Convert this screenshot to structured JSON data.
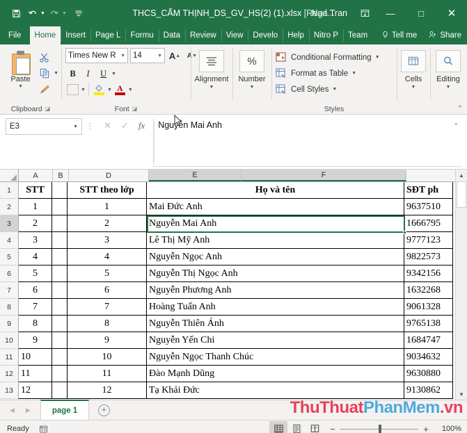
{
  "titlebar": {
    "save_icon": "save-icon",
    "undo_icon": "undo-icon",
    "redo_icon": "redo-icon",
    "customize_icon": "customize-quick-access-icon",
    "document_title": "THCS_CẤM THỊNH_DS_GV_HS(2) (1).xlsx",
    "readonly_tag": "[Read...",
    "user_name": "Nga Tran",
    "ribbon_display_icon": "ribbon-display-options-icon",
    "minimize": "—",
    "maximize": "□",
    "close": "✕"
  },
  "ribbon_tabs": [
    {
      "label": "File",
      "active": false
    },
    {
      "label": "Home",
      "active": true
    },
    {
      "label": "Insert",
      "active": false
    },
    {
      "label": "Page L",
      "active": false
    },
    {
      "label": "Formu",
      "active": false
    },
    {
      "label": "Data",
      "active": false
    },
    {
      "label": "Review",
      "active": false
    },
    {
      "label": "View",
      "active": false
    },
    {
      "label": "Develo",
      "active": false
    },
    {
      "label": "Help",
      "active": false
    },
    {
      "label": "Nitro P",
      "active": false
    },
    {
      "label": "Team",
      "active": false
    }
  ],
  "ribbon_right": {
    "tell_me": "Tell me",
    "tell_me_icon": "lightbulb-icon",
    "share": "Share",
    "share_icon": "share-person-icon"
  },
  "ribbon": {
    "clipboard": {
      "group_label": "Clipboard",
      "paste_label": "Paste",
      "paste_icon": "paste-clipboard-icon",
      "cut_icon": "scissors-icon",
      "copy_icon": "copy-icon",
      "format_painter_icon": "format-painter-icon",
      "launcher_icon": "dialog-launcher-icon"
    },
    "font": {
      "group_label": "Font",
      "font_name": "Times New R",
      "font_size": "14",
      "bold": "B",
      "italic": "I",
      "underline": "U",
      "increase_font": "A",
      "decrease_font": "A",
      "borders_icon": "borders-icon",
      "fill_color_icon": "fill-color-icon",
      "font_color_icon": "font-color-icon",
      "fill_color": "#ffe600",
      "font_color": "#c00000",
      "launcher_icon": "dialog-launcher-icon"
    },
    "alignment": {
      "label": "Alignment",
      "icon": "alignment-icon"
    },
    "number": {
      "label": "Number",
      "icon": "percent-icon",
      "glyph": "%"
    },
    "styles": {
      "group_label": "Styles",
      "items": [
        {
          "label": "Conditional Formatting",
          "icon": "conditional-formatting-icon"
        },
        {
          "label": "Format as Table",
          "icon": "format-as-table-icon"
        },
        {
          "label": "Cell Styles",
          "icon": "cell-styles-icon"
        }
      ]
    },
    "cells": {
      "label": "Cells",
      "icon": "cells-icon"
    },
    "editing": {
      "label": "Editing",
      "icon": "find-select-icon"
    },
    "collapse_ribbon_icon": "collapse-ribbon-chevron-icon"
  },
  "formula_bar": {
    "name_box_value": "E3",
    "name_box_caret_icon": "chevron-down-icon",
    "cancel_icon": "cancel-x-icon",
    "enter_icon": "enter-check-icon",
    "insert_function_icon": "fx-icon",
    "formula_value": "Nguyễn Mai Anh",
    "expand_icon": "expand-formula-bar-icon"
  },
  "grid": {
    "columns": [
      {
        "letter": "A",
        "selected": false
      },
      {
        "letter": "B",
        "selected": false
      },
      {
        "letter": "D",
        "selected": false
      },
      {
        "letter": "E",
        "selected": true
      },
      {
        "letter": "F",
        "selected": true
      },
      {
        "letter": "",
        "selected": false
      }
    ],
    "row_numbers": [
      "1",
      "2",
      "3",
      "4",
      "5",
      "6",
      "7",
      "8",
      "9",
      "10",
      "11",
      "12",
      "13"
    ],
    "selected_row": "3",
    "header_row": {
      "stt": "STT",
      "stt_theo_lop": "STT theo lớp",
      "ho_va_ten": "Họ và tên",
      "sdt": "SĐT ph"
    },
    "rows": [
      {
        "stt": "1",
        "stt_lop": "1",
        "name": "Mai Đức Anh",
        "sdt": "9637510"
      },
      {
        "stt": "2",
        "stt_lop": "2",
        "name": "Nguyễn Mai Anh",
        "sdt": "1666795"
      },
      {
        "stt": "3",
        "stt_lop": "3",
        "name": "Lê Thị Mỹ Anh",
        "sdt": "9777123"
      },
      {
        "stt": "4",
        "stt_lop": "4",
        "name": "Nguyễn Ngọc Anh",
        "sdt": "9822573"
      },
      {
        "stt": "5",
        "stt_lop": "5",
        "name": "Nguyễn Thị Ngọc Anh",
        "sdt": "9342156"
      },
      {
        "stt": "6",
        "stt_lop": "6",
        "name": "Nguyễn Phương Anh",
        "sdt": "1632268"
      },
      {
        "stt": "7",
        "stt_lop": "7",
        "name": "Hoàng Tuấn Anh",
        "sdt": "9061328"
      },
      {
        "stt": "8",
        "stt_lop": "8",
        "name": "Nguyễn Thiên Ánh",
        "sdt": "9765138"
      },
      {
        "stt": "9",
        "stt_lop": "9",
        "name": "Nguyễn Yến Chi",
        "sdt": "1684747"
      },
      {
        "stt": "10",
        "stt_lop": "10",
        "name": "Nguyễn Ngọc Thanh Chúc",
        "sdt": "9034632"
      },
      {
        "stt": "11",
        "stt_lop": "11",
        "name": "Đào Mạnh Dũng",
        "sdt": "9630880"
      },
      {
        "stt": "12",
        "stt_lop": "12",
        "name": "Tạ Khải Đức",
        "sdt": "9130862"
      }
    ],
    "active_cell": "E3",
    "selection_color": "#217346",
    "scroll_up_icon": "scroll-up-arrow-icon",
    "scroll_down_icon": "scroll-down-arrow-icon"
  },
  "sheetbar": {
    "prev_icon": "previous-sheet-arrow-icon",
    "next_icon": "next-sheet-arrow-icon",
    "tabs": [
      {
        "label": "page 1",
        "active": true
      }
    ],
    "add_sheet_icon": "add-sheet-plus-icon",
    "add_sheet_glyph": "+",
    "watermark_part1": "ThuThuat",
    "watermark_part2": "PhanMem",
    "watermark_part3": ".vn",
    "watermark_color1": "#e8415a",
    "watermark_color2": "#4fa8dd"
  },
  "statusbar": {
    "status": "Ready",
    "accessibility_icon": "accessibility-checker-icon",
    "view_normal_icon": "normal-view-icon",
    "view_pagelayout_icon": "page-layout-view-icon",
    "view_pagebreak_icon": "page-break-preview-icon",
    "zoom_out": "−",
    "zoom_in": "+",
    "zoom_level": "100%"
  }
}
